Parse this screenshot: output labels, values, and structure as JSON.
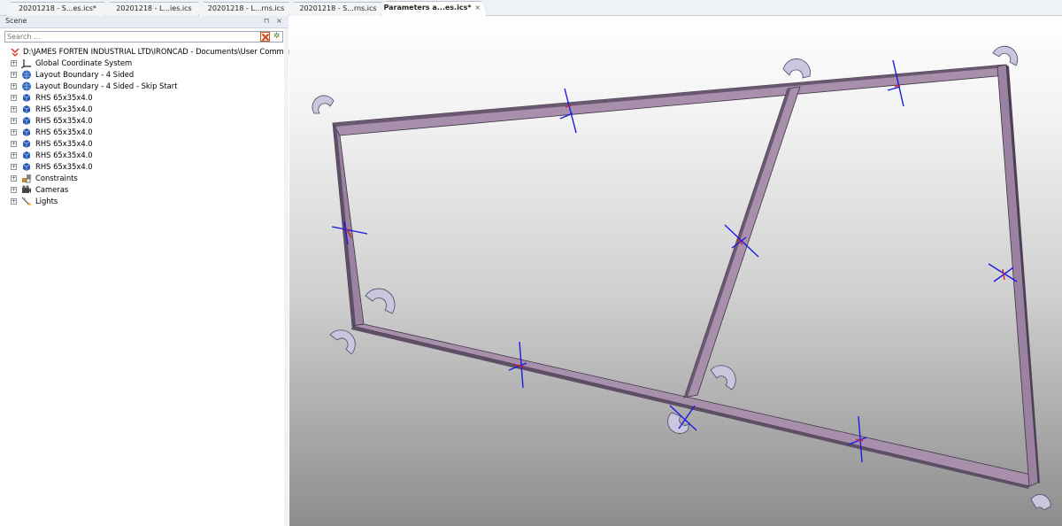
{
  "tabs": [
    {
      "label": "20201218 - S...es.ics*",
      "active": false
    },
    {
      "label": "20201218 - L...ies.ics",
      "active": false
    },
    {
      "label": "20201218 - L...rns.ics",
      "active": false
    },
    {
      "label": "20201218 - S...rns.ics",
      "active": false
    },
    {
      "label": "Parameters a...es.ics*",
      "active": true,
      "close": "×"
    }
  ],
  "scene_panel": {
    "title": "Scene",
    "pin_glyph": "⊓",
    "close_glyph": "×",
    "search_placeholder": "Search ..."
  },
  "tree": {
    "root": "D:\\JAMES FORTEN INDUSTRIAL LTD\\IRONCAD - Documents\\User Communit",
    "items": [
      {
        "label": "Global Coordinate System",
        "icon": "coordinate-system-icon"
      },
      {
        "label": "Layout Boundary - 4 Sided",
        "icon": "layout-boundary-icon"
      },
      {
        "label": "Layout Boundary - 4 Sided - Skip Start",
        "icon": "layout-boundary-icon"
      },
      {
        "label": "RHS 65x35x4.0",
        "icon": "part-icon"
      },
      {
        "label": "RHS 65x35x4.0",
        "icon": "part-icon"
      },
      {
        "label": "RHS 65x35x4.0",
        "icon": "part-icon"
      },
      {
        "label": "RHS 65x35x4.0",
        "icon": "part-icon"
      },
      {
        "label": "RHS 65x35x4.0",
        "icon": "part-icon"
      },
      {
        "label": "RHS 65x35x4.0",
        "icon": "part-icon"
      },
      {
        "label": "RHS 65x35x4.0",
        "icon": "part-icon"
      },
      {
        "label": "Constraints",
        "icon": "constraints-icon"
      },
      {
        "label": "Cameras",
        "icon": "cameras-icon"
      },
      {
        "label": "Lights",
        "icon": "lights-icon"
      }
    ]
  },
  "colors": {
    "frame_fill": "#a88fac",
    "frame_dark": "#5e4f66",
    "frame_edge": "#3a3340",
    "handle_blue": "#1a1ae6",
    "handle_red": "#d62020",
    "elbow_fill": "#c9c6dd"
  }
}
